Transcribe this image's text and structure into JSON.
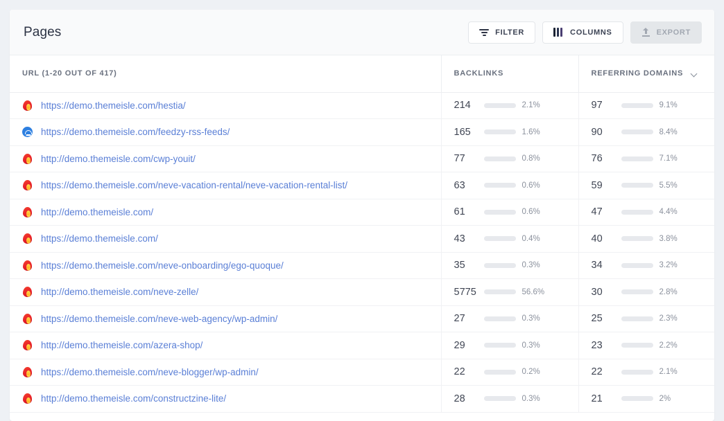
{
  "header": {
    "title": "Pages",
    "buttons": [
      {
        "label": "FILTER",
        "icon": "filter-icon",
        "disabled": false
      },
      {
        "label": "COLUMNS",
        "icon": "columns-icon",
        "disabled": false
      },
      {
        "label": "EXPORT",
        "icon": "export-icon",
        "disabled": true
      }
    ]
  },
  "table": {
    "columns": [
      {
        "key": "url",
        "label": "URL (1-20 OUT OF 417)",
        "sort_icon": null
      },
      {
        "key": "bl",
        "label": "BACKLINKS",
        "sort_icon": null
      },
      {
        "key": "rd",
        "label": "REFERRING DOMAINS",
        "sort_icon": "chevron-down-icon"
      }
    ],
    "range_start": 1,
    "range_end": 20,
    "total": 417,
    "colors": {
      "bar_track": "#e7e9ed",
      "bar_gray": "#c7ccd4",
      "bar_green": "#2e9e5b",
      "bar_blue": "#1a7fd4",
      "link": "#5a7fd6"
    },
    "rows": [
      {
        "favicon": "themeisle-flame-icon",
        "url": "https://demo.themeisle.com/hestia/",
        "backlinks": "214",
        "backlinks_pct": "2.1%",
        "backlinks_bar": 4,
        "backlinks_color": "#c7ccd4",
        "domains": "97",
        "domains_pct": "9.1%",
        "domains_bar": 9,
        "domains_color": "#2e9e5b"
      },
      {
        "favicon": "feedzy-rss-icon",
        "url": "https://demo.themeisle.com/feedzy-rss-feeds/",
        "backlinks": "165",
        "backlinks_pct": "1.6%",
        "backlinks_bar": 3,
        "backlinks_color": "#c7ccd4",
        "domains": "90",
        "domains_pct": "8.4%",
        "domains_bar": 8,
        "domains_color": "#2e9e5b"
      },
      {
        "favicon": "themeisle-flame-icon",
        "url": "http://demo.themeisle.com/cwp-youit/",
        "backlinks": "77",
        "backlinks_pct": "0.8%",
        "backlinks_bar": 2,
        "backlinks_color": "#c7ccd4",
        "domains": "76",
        "domains_pct": "7.1%",
        "domains_bar": 7,
        "domains_color": "#2e9e5b"
      },
      {
        "favicon": "themeisle-flame-icon",
        "url": "https://demo.themeisle.com/neve-vacation-rental/neve-vacation-rental-list/",
        "backlinks": "63",
        "backlinks_pct": "0.6%",
        "backlinks_bar": 2,
        "backlinks_color": "#c7ccd4",
        "domains": "59",
        "domains_pct": "5.5%",
        "domains_bar": 6,
        "domains_color": "#c7ccd4"
      },
      {
        "favicon": "themeisle-flame-icon",
        "url": "http://demo.themeisle.com/",
        "backlinks": "61",
        "backlinks_pct": "0.6%",
        "backlinks_bar": 2,
        "backlinks_color": "#c7ccd4",
        "domains": "47",
        "domains_pct": "4.4%",
        "domains_bar": 5,
        "domains_color": "#c7ccd4"
      },
      {
        "favicon": "themeisle-flame-icon",
        "url": "https://demo.themeisle.com/",
        "backlinks": "43",
        "backlinks_pct": "0.4%",
        "backlinks_bar": 2,
        "backlinks_color": "#c7ccd4",
        "domains": "40",
        "domains_pct": "3.8%",
        "domains_bar": 4,
        "domains_color": "#c7ccd4"
      },
      {
        "favicon": "themeisle-flame-icon",
        "url": "https://demo.themeisle.com/neve-onboarding/ego-quoque/",
        "backlinks": "35",
        "backlinks_pct": "0.3%",
        "backlinks_bar": 2,
        "backlinks_color": "#c7ccd4",
        "domains": "34",
        "domains_pct": "3.2%",
        "domains_bar": 4,
        "domains_color": "#c7ccd4"
      },
      {
        "favicon": "themeisle-flame-icon",
        "url": "http://demo.themeisle.com/neve-zelle/",
        "backlinks": "5775",
        "backlinks_pct": "56.6%",
        "backlinks_bar": 57,
        "backlinks_color": "#1a7fd4",
        "domains": "30",
        "domains_pct": "2.8%",
        "domains_bar": 3,
        "domains_color": "#c7ccd4"
      },
      {
        "favicon": "themeisle-flame-icon",
        "url": "https://demo.themeisle.com/neve-web-agency/wp-admin/",
        "backlinks": "27",
        "backlinks_pct": "0.3%",
        "backlinks_bar": 2,
        "backlinks_color": "#c7ccd4",
        "domains": "25",
        "domains_pct": "2.3%",
        "domains_bar": 3,
        "domains_color": "#c7ccd4"
      },
      {
        "favicon": "themeisle-flame-icon",
        "url": "http://demo.themeisle.com/azera-shop/",
        "backlinks": "29",
        "backlinks_pct": "0.3%",
        "backlinks_bar": 2,
        "backlinks_color": "#c7ccd4",
        "domains": "23",
        "domains_pct": "2.2%",
        "domains_bar": 3,
        "domains_color": "#c7ccd4"
      },
      {
        "favicon": "themeisle-flame-icon",
        "url": "https://demo.themeisle.com/neve-blogger/wp-admin/",
        "backlinks": "22",
        "backlinks_pct": "0.2%",
        "backlinks_bar": 1,
        "backlinks_color": "#c7ccd4",
        "domains": "22",
        "domains_pct": "2.1%",
        "domains_bar": 3,
        "domains_color": "#c7ccd4"
      },
      {
        "favicon": "themeisle-flame-icon",
        "url": "http://demo.themeisle.com/constructzine-lite/",
        "backlinks": "28",
        "backlinks_pct": "0.3%",
        "backlinks_bar": 2,
        "backlinks_color": "#c7ccd4",
        "domains": "21",
        "domains_pct": "2%",
        "domains_bar": 3,
        "domains_color": "#c7ccd4"
      }
    ]
  }
}
